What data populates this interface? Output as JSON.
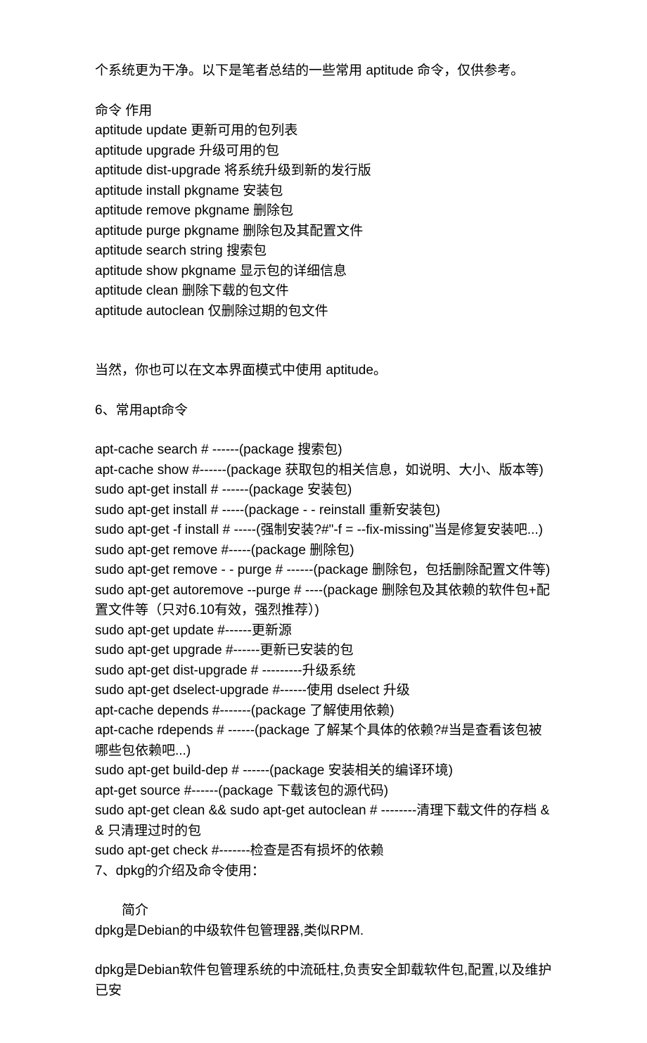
{
  "intro": "个系统更为干净。以下是笔者总结的一些常用 aptitude 命令，仅供参考。",
  "cmd_header": "命令 作用",
  "aptitude_cmds": [
    "aptitude update 更新可用的包列表",
    "aptitude upgrade 升级可用的包",
    "aptitude dist-upgrade 将系统升级到新的发行版",
    "aptitude install pkgname 安装包",
    "aptitude remove pkgname 删除包",
    "aptitude purge pkgname 删除包及其配置文件",
    "aptitude search string 搜索包",
    "aptitude show pkgname 显示包的详细信息",
    "aptitude clean 删除下载的包文件",
    "aptitude autoclean 仅删除过期的包文件"
  ],
  "aptitude_note": "当然，你也可以在文本界面模式中使用 aptitude。",
  "section6_title": "6、常用apt命令",
  "apt_cmds": [
    "apt-cache search # ------(package 搜索包)",
    "apt-cache show #------(package 获取包的相关信息，如说明、大小、版本等)",
    "sudo apt-get install # ------(package 安装包)",
    "sudo apt-get install # -----(package - - reinstall 重新安装包)",
    "sudo apt-get -f install # -----(强制安装?#\"-f = --fix-missing\"当是修复安装吧...)",
    "sudo apt-get remove #-----(package 删除包)",
    "sudo apt-get remove - - purge # ------(package 删除包，包括删除配置文件等)",
    "sudo apt-get autoremove --purge # ----(package 删除包及其依赖的软件包+配置文件等（只对6.10有效，强烈推荐）)",
    "sudo apt-get update #------更新源",
    "sudo apt-get upgrade #------更新已安装的包",
    "sudo apt-get dist-upgrade # ---------升级系统",
    "sudo apt-get dselect-upgrade #------使用 dselect 升级",
    "apt-cache depends #-------(package 了解使用依赖)",
    "apt-cache rdepends # ------(package 了解某个具体的依赖?#当是查看该包被哪些包依赖吧...)",
    "sudo apt-get build-dep # ------(package 安装相关的编译环境)",
    "apt-get source #------(package 下载该包的源代码)",
    "sudo apt-get clean && sudo apt-get autoclean # --------清理下载文件的存档 && 只清理过时的包",
    "sudo apt-get check #-------检查是否有损坏的依赖"
  ],
  "section7_title": "7、dpkg的介绍及命令使用：",
  "dpkg_intro_label": "简介",
  "dpkg_line1": "dpkg是Debian的中级软件包管理器,类似RPM.",
  "dpkg_line2": "dpkg是Debian软件包管理系统的中流砥柱,负责安全卸载软件包,配置,以及维护已安"
}
